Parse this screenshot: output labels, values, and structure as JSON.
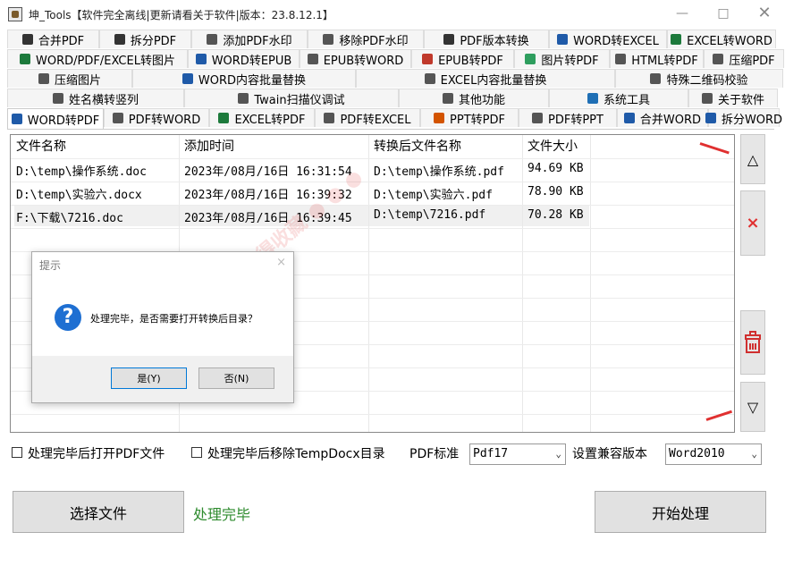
{
  "window": {
    "title": "坤_Tools【软件完全离线|更新请看关于软件|版本：23.8.12.1】",
    "minimize_icon": "minimize-icon",
    "maximize_icon": "maximize-icon",
    "close_icon": "close-icon"
  },
  "tabs": {
    "row1": [
      {
        "label": "合并PDF",
        "icon": "pdf-merge-icon",
        "color": "#333"
      },
      {
        "label": "拆分PDF",
        "icon": "pdf-split-icon",
        "color": "#333"
      },
      {
        "label": "添加PDF水印",
        "icon": "watermark-add-icon",
        "color": "#555"
      },
      {
        "label": "移除PDF水印",
        "icon": "watermark-remove-icon",
        "color": "#555"
      },
      {
        "label": "PDF版本转换",
        "icon": "pdf-version-icon",
        "color": "#333"
      },
      {
        "label": "WORD转EXCEL",
        "icon": "word-excel-icon",
        "color": "#1f5aa8"
      },
      {
        "label": "EXCEL转WORD",
        "icon": "excel-word-icon",
        "color": "#1d7a3c"
      }
    ],
    "row2": [
      {
        "label": "WORD/PDF/EXCEL转图片",
        "icon": "to-image-icon",
        "color": "#1d7a3c"
      },
      {
        "label": "WORD转EPUB",
        "icon": "word-epub-icon",
        "color": "#1f5aa8"
      },
      {
        "label": "EPUB转WORD",
        "icon": "epub-word-icon",
        "color": "#555"
      },
      {
        "label": "EPUB转PDF",
        "icon": "epub-pdf-icon",
        "color": "#c0392b"
      },
      {
        "label": "图片转PDF",
        "icon": "image-pdf-icon",
        "color": "#2e9e5e"
      },
      {
        "label": "HTML转PDF",
        "icon": "html-pdf-icon",
        "color": "#555"
      },
      {
        "label": "压缩PDF",
        "icon": "compress-pdf-icon",
        "color": "#555"
      }
    ],
    "row3": [
      {
        "label": "压缩图片",
        "icon": "compress-image-icon",
        "color": "#555"
      },
      {
        "label": "WORD内容批量替换",
        "icon": "word-replace-icon",
        "color": "#1f5aa8"
      },
      {
        "label": "EXCEL内容批量替换",
        "icon": "excel-replace-icon",
        "color": "#555"
      },
      {
        "label": "特殊二维码校验",
        "icon": "qrcode-icon",
        "color": "#555"
      }
    ],
    "row4": [
      {
        "label": "姓名横转竖列",
        "icon": "name-convert-icon",
        "color": "#555"
      },
      {
        "label": "Twain扫描仪调试",
        "icon": "scanner-icon",
        "color": "#555"
      },
      {
        "label": "其他功能",
        "icon": "more-icon",
        "color": "#555"
      },
      {
        "label": "系统工具",
        "icon": "gear-icon",
        "color": "#1f6fb5"
      },
      {
        "label": "关于软件",
        "icon": "info-icon",
        "color": "#555"
      }
    ],
    "row5": [
      {
        "label": "WORD转PDF",
        "icon": "word-pdf-icon",
        "color": "#1f5aa8",
        "active": true
      },
      {
        "label": "PDF转WORD",
        "icon": "pdf-word-icon",
        "color": "#555"
      },
      {
        "label": "EXCEL转PDF",
        "icon": "excel-pdf-icon",
        "color": "#1d7a3c"
      },
      {
        "label": "PDF转EXCEL",
        "icon": "pdf-excel-icon",
        "color": "#555"
      },
      {
        "label": "PPT转PDF",
        "icon": "ppt-pdf-icon",
        "color": "#d35400"
      },
      {
        "label": "PDF转PPT",
        "icon": "pdf-ppt-icon",
        "color": "#555"
      },
      {
        "label": "合并WORD",
        "icon": "word-merge-icon",
        "color": "#1f5aa8"
      },
      {
        "label": "拆分WORD",
        "icon": "word-split-icon",
        "color": "#1f5aa8"
      }
    ]
  },
  "table": {
    "headers": [
      "文件名称",
      "添加时间",
      "转换后文件名称",
      "文件大小"
    ],
    "rows": [
      {
        "name": "D:\\temp\\操作系统.doc",
        "time": "2023年/08月/16日  16:31:54",
        "output": "D:\\temp\\操作系统.pdf",
        "size": "94.69 KB"
      },
      {
        "name": "D:\\temp\\实验六.docx",
        "time": "2023年/08月/16日  16:39:32",
        "output": "D:\\temp\\实验六.pdf",
        "size": "78.90 KB"
      },
      {
        "name": "F:\\下载\\7216.doc",
        "time": "2023年/08月/16日  16:39:45",
        "output": "D:\\temp\\7216.pdf",
        "size": "70.28 KB"
      }
    ]
  },
  "side_buttons": {
    "move_up": "△",
    "delete": "×",
    "clear_icon": "trash-icon",
    "move_down": "▽"
  },
  "dialog": {
    "title": "提示",
    "close": "×",
    "icon": "?",
    "message": "处理完毕，是否需要打开转换后目录？",
    "yes": "是(Y)",
    "no": "否(N)"
  },
  "options": {
    "open_pdf_label": "处理完毕后打开PDF文件",
    "remove_temp_label": "处理完毕后移除TempDocx目录",
    "pdf_standard_label": "PDF标准",
    "pdf_standard_value": "Pdf17",
    "compat_label": "设置兼容版本",
    "compat_value": "Word2010"
  },
  "actions": {
    "select_file": "选择文件",
    "status": "处理完毕",
    "start": "开始处理"
  },
  "colors": {
    "status_green": "#2e8b2e",
    "delete_red": "#e03030",
    "dialog_icon_blue": "#1e6fd2"
  }
}
